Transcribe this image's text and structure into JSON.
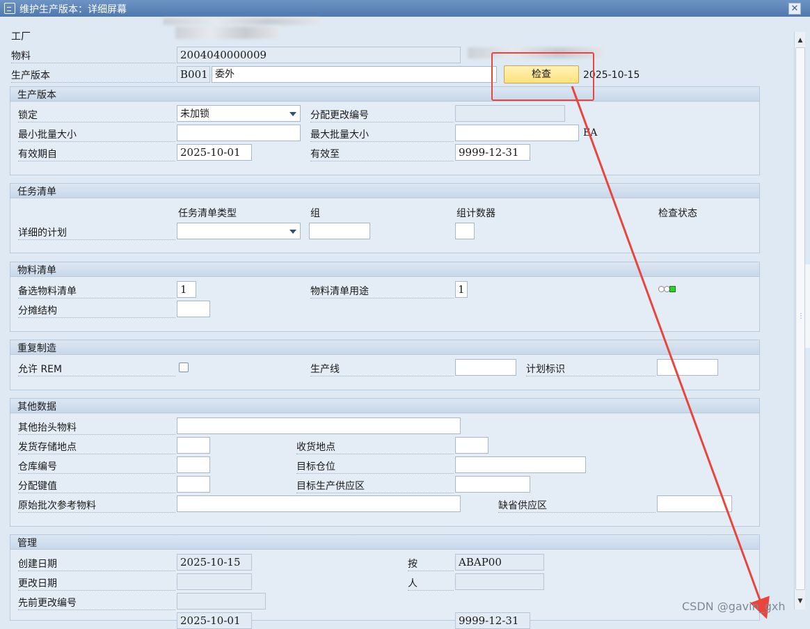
{
  "window": {
    "title": "维护生产版本：详细屏幕"
  },
  "header": {
    "plant_label": "工厂",
    "material_label": "物料",
    "material_value": "2004040000009",
    "version_label": "生产版本",
    "version_code": "B001",
    "version_text": "委外",
    "check_button": "检查",
    "check_date": "2025-10-15"
  },
  "prod_version": {
    "title": "生产版本",
    "lock_label": "锁定",
    "lock_value": "未加锁",
    "change_no_label": "分配更改编号",
    "change_no_value": "",
    "min_lot_label": "最小批量大小",
    "min_lot_value": "",
    "max_lot_label": "最大批量大小",
    "max_lot_value": "",
    "unit": "EA",
    "valid_from_label": "有效期自",
    "valid_from_value": "2025-10-01",
    "valid_to_label": "有效至",
    "valid_to_value": "9999-12-31"
  },
  "task_list": {
    "title": "任务清单",
    "col_type": "任务清单类型",
    "col_group": "组",
    "col_counter": "组计数器",
    "col_status": "检查状态",
    "detail_label": "详细的计划",
    "type_value": "",
    "group_value": "",
    "counter_value": ""
  },
  "bom": {
    "title": "物料清单",
    "alt_label": "备选物料清单",
    "alt_value": "1",
    "usage_label": "物料清单用途",
    "usage_value": "1",
    "apportion_label": "分摊结构",
    "apportion_value": "",
    "status_colors": {
      "green": "#2ccf2c"
    }
  },
  "rem": {
    "title": "重复制造",
    "allow_label": "允许 REM",
    "allow_checked": false,
    "line_label": "生产线",
    "line_value": "",
    "plan_id_label": "计划标识",
    "plan_id_value": ""
  },
  "other": {
    "title": "其他数据",
    "other_header_label": "其他抬头物料",
    "other_header_value": "",
    "issue_sloc_label": "发货存储地点",
    "issue_sloc_value": "",
    "recv_loc_label": "收货地点",
    "recv_loc_value": "",
    "wh_label": "仓库编号",
    "wh_value": "",
    "target_bin_label": "目标仓位",
    "target_bin_value": "",
    "dist_key_label": "分配键值",
    "dist_key_value": "",
    "target_supply_label": "目标生产供应区",
    "target_supply_value": "",
    "orig_batch_label": "原始批次参考物料",
    "orig_batch_value": "",
    "default_supply_label": "缺省供应区",
    "default_supply_value": ""
  },
  "admin": {
    "title": "管理",
    "created_label": "创建日期",
    "created_value": "2025-10-15",
    "by_label": "按",
    "by_value": "ABAP00",
    "changed_label": "更改日期",
    "changed_value": "",
    "person_label": "人",
    "person_value": "",
    "prev_change_label": "先前更改编号",
    "prev_change_value": "",
    "valid_from_value": "2025-10-01",
    "valid_to_value": "9999-12-31"
  },
  "footer": {
    "watermark": "CSDN @gavin_gxh"
  },
  "colors": {
    "title_bar": "#5b82b8",
    "annotation_red": "#e8453c",
    "check_button": "#ffe07a"
  }
}
